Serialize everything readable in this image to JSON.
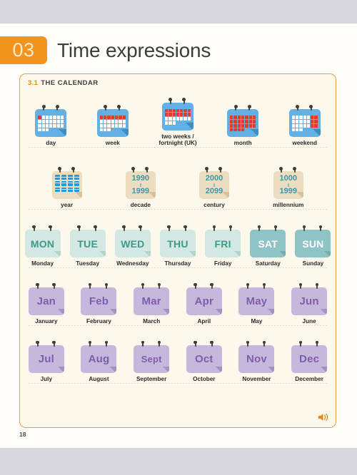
{
  "chapter": {
    "number": "03",
    "title": "Time expressions"
  },
  "section": {
    "number": "3.1",
    "name": "THE CALENDAR"
  },
  "page_number": "18",
  "audio_icon": "speaker-icon",
  "colors": {
    "accent_orange": "#f0941e",
    "panel_border": "#e6a03a",
    "panel_bg": "#fdf8ec",
    "calendar_blue": "#63b0e4",
    "calendar_red": "#e03c2e",
    "tile_beige": "#ecdcc0",
    "year_teal": "#3e96a6",
    "weekday_bg": "#d3e8e2",
    "weekday_text": "#3c9a8b",
    "weekend_bg": "#8fc4c6",
    "weekend_text": "#ffffff",
    "month_bg": "#c6b7dd",
    "month_text": "#7d5fa8",
    "band_gray": "#d6d6dc"
  },
  "rows": {
    "periods": [
      {
        "icon": "calendar-day-icon",
        "caption": "day"
      },
      {
        "icon": "calendar-week-icon",
        "caption": "week"
      },
      {
        "icon": "calendar-fortnight-icon",
        "caption": "two weeks /\nfortnight (UK)"
      },
      {
        "icon": "calendar-month-icon",
        "caption": "month"
      },
      {
        "icon": "calendar-weekend-icon",
        "caption": "weekend"
      }
    ],
    "spans": [
      {
        "icon": "calendar-year-icon",
        "caption": "year",
        "from": "",
        "to": ""
      },
      {
        "icon": "calendar-decade-icon",
        "caption": "decade",
        "from": "1990",
        "to": "1999"
      },
      {
        "icon": "calendar-century-icon",
        "caption": "century",
        "from": "2000",
        "to": "2099"
      },
      {
        "icon": "calendar-millennium-icon",
        "caption": "millennium",
        "from": "1000",
        "to": "1999"
      }
    ],
    "days": [
      {
        "abbr": "MON",
        "name": "Monday",
        "weekend": false
      },
      {
        "abbr": "TUE",
        "name": "Tuesday",
        "weekend": false
      },
      {
        "abbr": "WED",
        "name": "Wednesday",
        "weekend": false
      },
      {
        "abbr": "THU",
        "name": "Thursday",
        "weekend": false
      },
      {
        "abbr": "FRI",
        "name": "Friday",
        "weekend": false
      },
      {
        "abbr": "SAT",
        "name": "Saturday",
        "weekend": true
      },
      {
        "abbr": "SUN",
        "name": "Sunday",
        "weekend": true
      }
    ],
    "months_first": [
      {
        "abbr": "Jan",
        "name": "January"
      },
      {
        "abbr": "Feb",
        "name": "February"
      },
      {
        "abbr": "Mar",
        "name": "March"
      },
      {
        "abbr": "Apr",
        "name": "April"
      },
      {
        "abbr": "May",
        "name": "May"
      },
      {
        "abbr": "Jun",
        "name": "June"
      }
    ],
    "months_second": [
      {
        "abbr": "Jul",
        "name": "July"
      },
      {
        "abbr": "Aug",
        "name": "August"
      },
      {
        "abbr": "Sept",
        "name": "September"
      },
      {
        "abbr": "Oct",
        "name": "October"
      },
      {
        "abbr": "Nov",
        "name": "November"
      },
      {
        "abbr": "Dec",
        "name": "December"
      }
    ]
  }
}
